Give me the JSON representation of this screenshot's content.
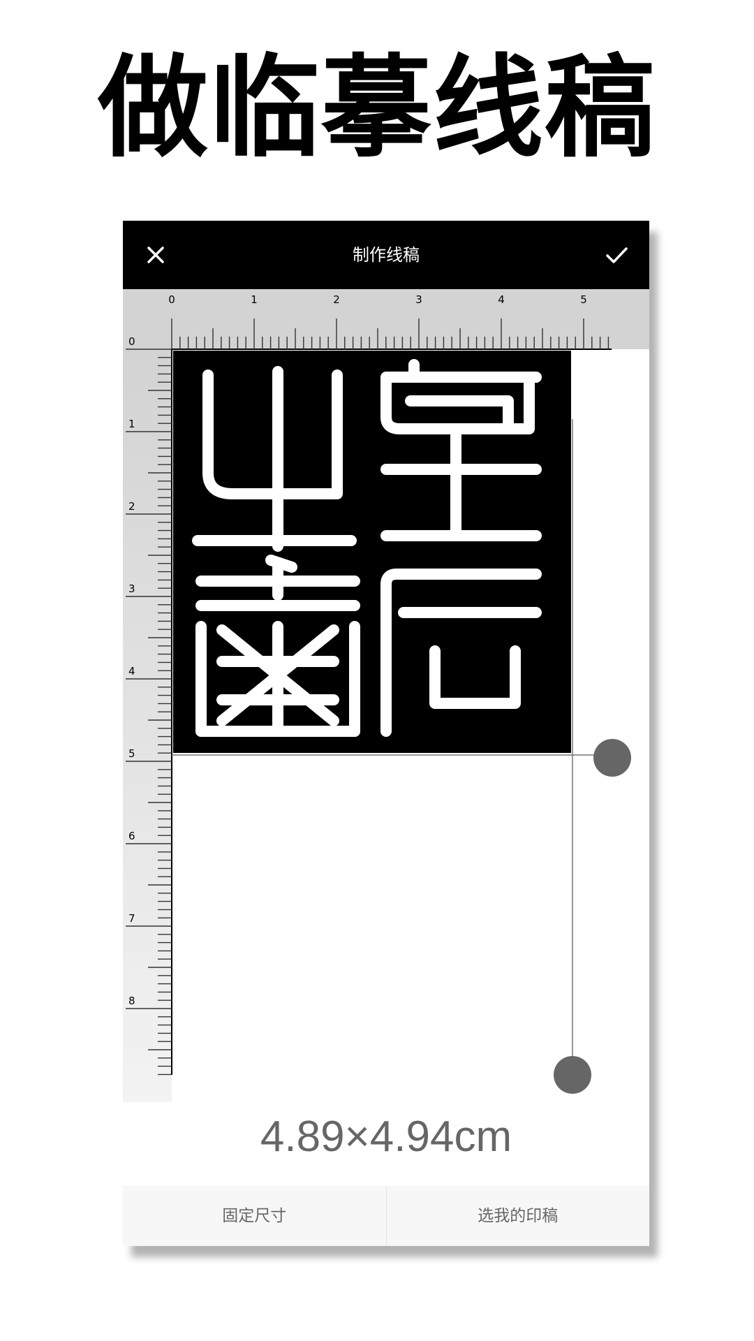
{
  "promo": {
    "heading": "做临摹线稿"
  },
  "topbar": {
    "title": "制作线稿",
    "close_icon": "close-icon",
    "confirm_icon": "check-icon"
  },
  "ruler": {
    "top_labels": [
      "0",
      "1",
      "2",
      "3",
      "4",
      "5"
    ],
    "left_labels": [
      "0",
      "1",
      "2",
      "3",
      "4",
      "5",
      "6",
      "7",
      "8"
    ],
    "unit": "cm"
  },
  "stamp": {
    "characters": [
      "皇",
      "后",
      "山",
      "齋"
    ]
  },
  "selection": {
    "size_text": "4.89×4.94cm"
  },
  "bottom_bar": {
    "fixed_size_label": "固定尺寸",
    "choose_mine_label": "选我的印稿"
  },
  "colors": {
    "topbar_bg": "#000000",
    "ruler_bg": "#d3d3d3",
    "handle": "#666666",
    "text_gray": "#666666"
  }
}
